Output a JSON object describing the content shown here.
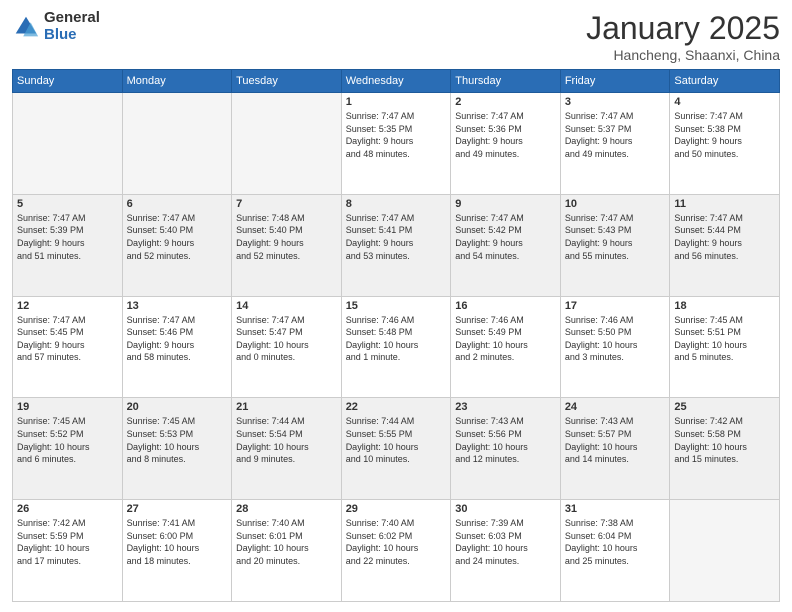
{
  "logo": {
    "general": "General",
    "blue": "Blue"
  },
  "title": {
    "month_year": "January 2025",
    "location": "Hancheng, Shaanxi, China"
  },
  "weekdays": [
    "Sunday",
    "Monday",
    "Tuesday",
    "Wednesday",
    "Thursday",
    "Friday",
    "Saturday"
  ],
  "weeks": [
    [
      {
        "day": "",
        "info": "",
        "empty": true
      },
      {
        "day": "",
        "info": "",
        "empty": true
      },
      {
        "day": "",
        "info": "",
        "empty": true
      },
      {
        "day": "1",
        "info": "Sunrise: 7:47 AM\nSunset: 5:35 PM\nDaylight: 9 hours\nand 48 minutes.",
        "empty": false
      },
      {
        "day": "2",
        "info": "Sunrise: 7:47 AM\nSunset: 5:36 PM\nDaylight: 9 hours\nand 49 minutes.",
        "empty": false
      },
      {
        "day": "3",
        "info": "Sunrise: 7:47 AM\nSunset: 5:37 PM\nDaylight: 9 hours\nand 49 minutes.",
        "empty": false
      },
      {
        "day": "4",
        "info": "Sunrise: 7:47 AM\nSunset: 5:38 PM\nDaylight: 9 hours\nand 50 minutes.",
        "empty": false
      }
    ],
    [
      {
        "day": "5",
        "info": "Sunrise: 7:47 AM\nSunset: 5:39 PM\nDaylight: 9 hours\nand 51 minutes.",
        "empty": false
      },
      {
        "day": "6",
        "info": "Sunrise: 7:47 AM\nSunset: 5:40 PM\nDaylight: 9 hours\nand 52 minutes.",
        "empty": false
      },
      {
        "day": "7",
        "info": "Sunrise: 7:48 AM\nSunset: 5:40 PM\nDaylight: 9 hours\nand 52 minutes.",
        "empty": false
      },
      {
        "day": "8",
        "info": "Sunrise: 7:47 AM\nSunset: 5:41 PM\nDaylight: 9 hours\nand 53 minutes.",
        "empty": false
      },
      {
        "day": "9",
        "info": "Sunrise: 7:47 AM\nSunset: 5:42 PM\nDaylight: 9 hours\nand 54 minutes.",
        "empty": false
      },
      {
        "day": "10",
        "info": "Sunrise: 7:47 AM\nSunset: 5:43 PM\nDaylight: 9 hours\nand 55 minutes.",
        "empty": false
      },
      {
        "day": "11",
        "info": "Sunrise: 7:47 AM\nSunset: 5:44 PM\nDaylight: 9 hours\nand 56 minutes.",
        "empty": false
      }
    ],
    [
      {
        "day": "12",
        "info": "Sunrise: 7:47 AM\nSunset: 5:45 PM\nDaylight: 9 hours\nand 57 minutes.",
        "empty": false
      },
      {
        "day": "13",
        "info": "Sunrise: 7:47 AM\nSunset: 5:46 PM\nDaylight: 9 hours\nand 58 minutes.",
        "empty": false
      },
      {
        "day": "14",
        "info": "Sunrise: 7:47 AM\nSunset: 5:47 PM\nDaylight: 10 hours\nand 0 minutes.",
        "empty": false
      },
      {
        "day": "15",
        "info": "Sunrise: 7:46 AM\nSunset: 5:48 PM\nDaylight: 10 hours\nand 1 minute.",
        "empty": false
      },
      {
        "day": "16",
        "info": "Sunrise: 7:46 AM\nSunset: 5:49 PM\nDaylight: 10 hours\nand 2 minutes.",
        "empty": false
      },
      {
        "day": "17",
        "info": "Sunrise: 7:46 AM\nSunset: 5:50 PM\nDaylight: 10 hours\nand 3 minutes.",
        "empty": false
      },
      {
        "day": "18",
        "info": "Sunrise: 7:45 AM\nSunset: 5:51 PM\nDaylight: 10 hours\nand 5 minutes.",
        "empty": false
      }
    ],
    [
      {
        "day": "19",
        "info": "Sunrise: 7:45 AM\nSunset: 5:52 PM\nDaylight: 10 hours\nand 6 minutes.",
        "empty": false
      },
      {
        "day": "20",
        "info": "Sunrise: 7:45 AM\nSunset: 5:53 PM\nDaylight: 10 hours\nand 8 minutes.",
        "empty": false
      },
      {
        "day": "21",
        "info": "Sunrise: 7:44 AM\nSunset: 5:54 PM\nDaylight: 10 hours\nand 9 minutes.",
        "empty": false
      },
      {
        "day": "22",
        "info": "Sunrise: 7:44 AM\nSunset: 5:55 PM\nDaylight: 10 hours\nand 10 minutes.",
        "empty": false
      },
      {
        "day": "23",
        "info": "Sunrise: 7:43 AM\nSunset: 5:56 PM\nDaylight: 10 hours\nand 12 minutes.",
        "empty": false
      },
      {
        "day": "24",
        "info": "Sunrise: 7:43 AM\nSunset: 5:57 PM\nDaylight: 10 hours\nand 14 minutes.",
        "empty": false
      },
      {
        "day": "25",
        "info": "Sunrise: 7:42 AM\nSunset: 5:58 PM\nDaylight: 10 hours\nand 15 minutes.",
        "empty": false
      }
    ],
    [
      {
        "day": "26",
        "info": "Sunrise: 7:42 AM\nSunset: 5:59 PM\nDaylight: 10 hours\nand 17 minutes.",
        "empty": false
      },
      {
        "day": "27",
        "info": "Sunrise: 7:41 AM\nSunset: 6:00 PM\nDaylight: 10 hours\nand 18 minutes.",
        "empty": false
      },
      {
        "day": "28",
        "info": "Sunrise: 7:40 AM\nSunset: 6:01 PM\nDaylight: 10 hours\nand 20 minutes.",
        "empty": false
      },
      {
        "day": "29",
        "info": "Sunrise: 7:40 AM\nSunset: 6:02 PM\nDaylight: 10 hours\nand 22 minutes.",
        "empty": false
      },
      {
        "day": "30",
        "info": "Sunrise: 7:39 AM\nSunset: 6:03 PM\nDaylight: 10 hours\nand 24 minutes.",
        "empty": false
      },
      {
        "day": "31",
        "info": "Sunrise: 7:38 AM\nSunset: 6:04 PM\nDaylight: 10 hours\nand 25 minutes.",
        "empty": false
      },
      {
        "day": "",
        "info": "",
        "empty": true
      }
    ]
  ]
}
